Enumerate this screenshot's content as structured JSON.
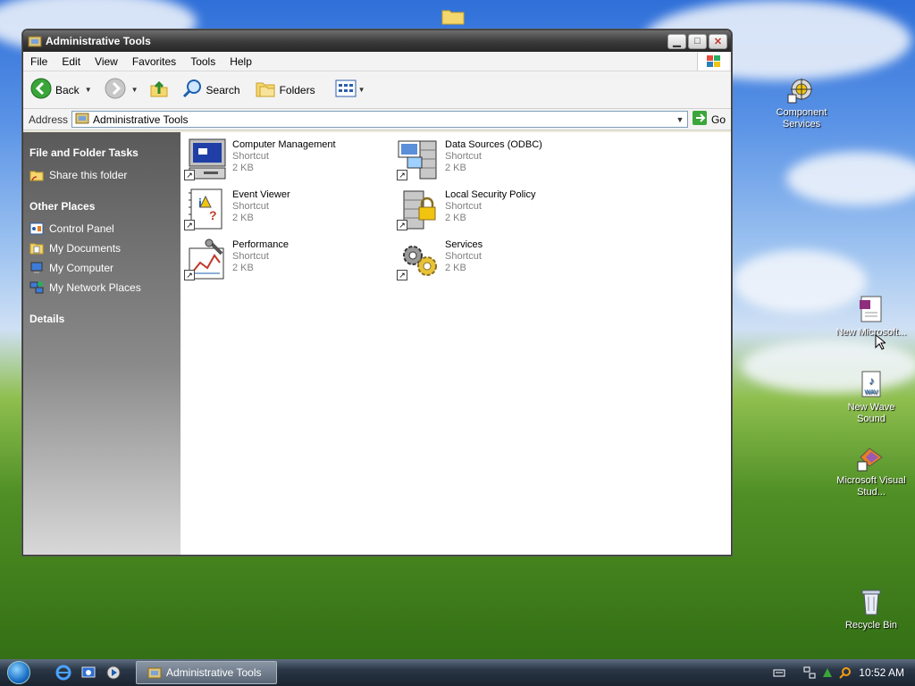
{
  "window": {
    "title": "Administrative Tools",
    "buttons": {
      "minimize": "▁",
      "maximize": "□",
      "close": "✕"
    }
  },
  "menu": [
    "File",
    "Edit",
    "View",
    "Favorites",
    "Tools",
    "Help"
  ],
  "toolbar": {
    "back": "Back",
    "search": "Search",
    "folders": "Folders"
  },
  "address": {
    "label": "Address",
    "value": "Administrative Tools",
    "go": "Go"
  },
  "sidebar": {
    "tasks_title": "File and Folder Tasks",
    "tasks": [
      "Share this folder"
    ],
    "places_title": "Other Places",
    "places": [
      "Control Panel",
      "My Documents",
      "My Computer",
      "My Network Places"
    ],
    "details_title": "Details"
  },
  "items": [
    {
      "name": "Computer Management",
      "type": "Shortcut",
      "size": "2 KB",
      "icon": "computer-management-icon"
    },
    {
      "name": "Data Sources (ODBC)",
      "type": "Shortcut",
      "size": "2 KB",
      "icon": "data-sources-icon"
    },
    {
      "name": "Event Viewer",
      "type": "Shortcut",
      "size": "2 KB",
      "icon": "event-viewer-icon"
    },
    {
      "name": "Local Security Policy",
      "type": "Shortcut",
      "size": "2 KB",
      "icon": "local-security-policy-icon"
    },
    {
      "name": "Performance",
      "type": "Shortcut",
      "size": "2 KB",
      "icon": "performance-icon"
    },
    {
      "name": "Services",
      "type": "Shortcut",
      "size": "2 KB",
      "icon": "services-icon"
    }
  ],
  "desktop": [
    {
      "label": "Component Services"
    },
    {
      "label": "New Microsoft..."
    },
    {
      "label": "New Wave Sound"
    },
    {
      "label": "Microsoft Visual Stud..."
    },
    {
      "label": "Recycle Bin"
    }
  ],
  "taskbar": {
    "task": "Administrative Tools",
    "clock": "10:52 AM"
  }
}
